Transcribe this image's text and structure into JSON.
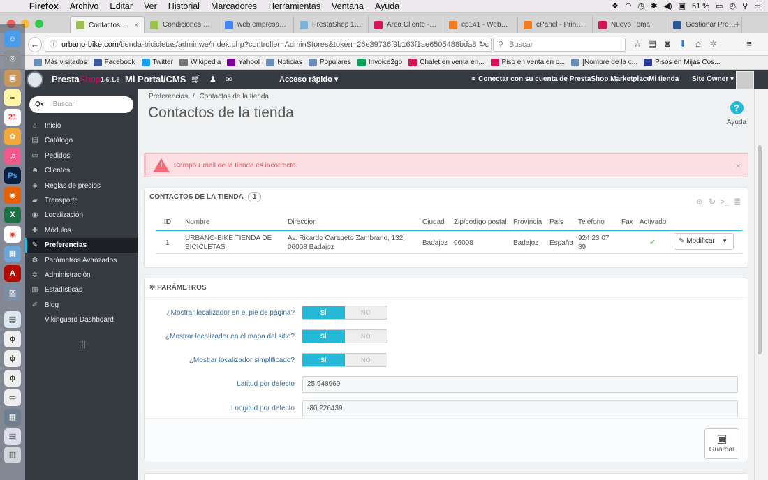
{
  "macbar": {
    "menus": [
      "Firefox",
      "Archivo",
      "Editar",
      "Ver",
      "Historial",
      "Marcadores",
      "Herramientas",
      "Ventana",
      "Ayuda"
    ],
    "battery": "51 %"
  },
  "tabs": [
    {
      "title": "Contactos de...",
      "color": "#9bc04d",
      "active": true
    },
    {
      "title": "Condiciones de ...",
      "color": "#9bc04d"
    },
    {
      "title": "web empresa - ...",
      "color": "#4285f4"
    },
    {
      "title": "PrestaShop 1.6.x...",
      "color": "#7db3d8"
    },
    {
      "title": "Área Cliente - W...",
      "color": "#d4145a"
    },
    {
      "title": "cp141 - WebHos...",
      "color": "#f47b20"
    },
    {
      "title": "cPanel - Principal",
      "color": "#f47b20"
    },
    {
      "title": "Nuevo Tema",
      "color": "#d4145a"
    },
    {
      "title": "Gestionar Prove...",
      "color": "#2b5797"
    }
  ],
  "nav": {
    "url_host": "urbano-bike.com",
    "url_rest": "/tienda-bicicletas/adminwe/index.php?controller=AdminStores&token=26e39736f9b163f1ae6505488bda891c",
    "search_placeholder": "Buscar"
  },
  "bookmarks": [
    "Más visitados",
    "Facebook",
    "Twitter",
    "Wikipedia",
    "Yahoo!",
    "Noticias",
    "Populares",
    "Invoice2go",
    "Chalet en venta en...",
    "Piso en venta en c...",
    "[Nombre de la c...",
    "Pisos en Mijas Cos..."
  ],
  "header": {
    "brand_a": "Presta",
    "brand_b": "Shop",
    "version": "1.6.1.5",
    "portal": "Mi Portal/CMS",
    "quick_access": "Acceso rápido ▾",
    "connect": "Conectar con su cuenta de PrestaShop Marketplace",
    "my_store": "Mi tienda",
    "owner": "Site Owner ▾"
  },
  "sidebar": {
    "search_placeholder": "Buscar",
    "items": [
      {
        "label": "Inicio",
        "icon": "⌂"
      },
      {
        "label": "Catálogo",
        "icon": "▤"
      },
      {
        "label": "Pedidos",
        "icon": "▭"
      },
      {
        "label": "Clientes",
        "icon": "☻"
      },
      {
        "label": "Reglas de precios",
        "icon": "◈"
      },
      {
        "label": "Transporte",
        "icon": "▰"
      },
      {
        "label": "Localización",
        "icon": "◉"
      },
      {
        "label": "Módulos",
        "icon": "✚"
      },
      {
        "label": "Preferencias",
        "icon": "✎"
      },
      {
        "label": "Parámetros Avanzados",
        "icon": "✻"
      },
      {
        "label": "Administración",
        "icon": "✲"
      },
      {
        "label": "Estadísticas",
        "icon": "▥"
      },
      {
        "label": "Blog",
        "icon": "✐"
      },
      {
        "label": "Vikinguard Dashboard",
        "icon": ""
      }
    ]
  },
  "page": {
    "breadcrumb_a": "Preferencias",
    "breadcrumb_sep": "/",
    "breadcrumb_b": "Contactos de la tienda",
    "title": "Contactos de la tienda",
    "help": "Ayuda",
    "alert": "Campo Email de la tienda es incorrecto."
  },
  "contacts": {
    "heading": "CONTACTOS DE LA TIENDA",
    "count": "1",
    "columns": [
      "ID",
      "Nombre",
      "Dirección",
      "Ciudad",
      "Zip/código postal",
      "Provincia",
      "País",
      "Teléfono",
      "Fax",
      "Activado"
    ],
    "row": {
      "id": "1",
      "name": "URBANO-BIKE TIENDA DE BICICLETAS",
      "address": "Av. Ricardo Carapeto Zambrano, 132, 06008 Badajoz",
      "city": "Badajoz",
      "zip": "06008",
      "province": "Badajoz",
      "country": "España",
      "phone": "924 23 07 89",
      "fax": "",
      "active": "✔"
    },
    "edit": "Modificar"
  },
  "params": {
    "heading": "PARÁMETROS",
    "toggle_on": "SÍ",
    "toggle_off": "NO",
    "f1": "¿Mostrar localizador en el pie de página?",
    "f2": "¿Mostrar localizador en el mapa del sitio?",
    "f3": "¿Mostrar localizador simplificado?",
    "lat_label": "Latitud por defecto",
    "lat_value": "25.948969",
    "lng_label": "Longitud por defecto",
    "lng_value": "-80.226439",
    "save": "Guardar"
  },
  "colors": {
    "accent": "#25b9d7",
    "header": "#363a41",
    "alert_bg": "#fbdfe2",
    "alert_text": "#e0535f"
  }
}
